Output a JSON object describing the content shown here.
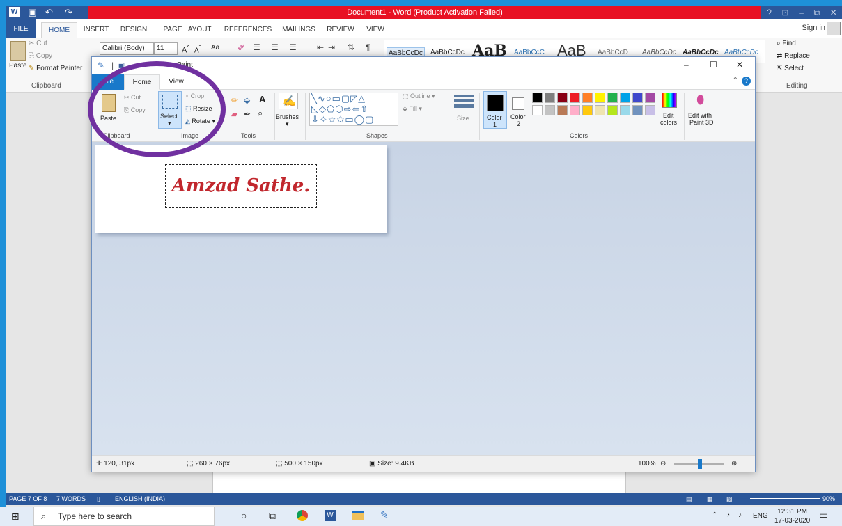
{
  "word": {
    "title": "Document1 - Word (Product Activation Failed)",
    "ctrl_icons": [
      "?",
      "⊡",
      "–",
      "⧉",
      "✕"
    ],
    "tabs": [
      "FILE",
      "HOME",
      "INSERT",
      "DESIGN",
      "PAGE LAYOUT",
      "REFERENCES",
      "MAILINGS",
      "REVIEW",
      "VIEW"
    ],
    "sign_in": "Sign in",
    "clipboard": {
      "paste": "Paste",
      "cut": "Cut",
      "copy": "Copy",
      "format_painter": "Format Painter",
      "label": "Clipboard"
    },
    "font": {
      "name": "Calibri (Body)",
      "size": "11",
      "case": "Aa"
    },
    "styles": [
      "AaBbCcDc",
      "AaBbCcDc",
      "AaB",
      "AaBbCcC",
      "AaB",
      "AaBbCcD",
      "AaBbCcDc",
      "AaBbCcDc",
      "AaBbCcDc"
    ],
    "editing": {
      "find": "Find",
      "replace": "Replace",
      "select": "Select",
      "label": "Editing"
    },
    "status": {
      "page": "PAGE 7 OF 8",
      "words": "7 WORDS",
      "language": "ENGLISH (INDIA)",
      "zoom": "90%"
    }
  },
  "paint": {
    "title": "Untitled - Paint",
    "title_suffix": "- Paint",
    "ctrl_icons": [
      "–",
      "☐",
      "✕"
    ],
    "tabs": [
      "File",
      "Home",
      "View"
    ],
    "clipboard": {
      "paste": "Paste",
      "cut": "Cut",
      "copy": "Copy",
      "label": "Clipboard"
    },
    "image": {
      "select": "Select",
      "crop": "Crop",
      "resize": "Resize",
      "rotate": "Rotate",
      "label": "Image"
    },
    "tools_label": "Tools",
    "brushes": "Brushes",
    "shapes": {
      "outline": "Outline",
      "fill": "Fill",
      "label": "Shapes"
    },
    "size": "Size",
    "colors": {
      "color1": "Color",
      "color1_num": "1",
      "color2": "Color",
      "color2_num": "2",
      "edit": "Edit",
      "edit2": "colors",
      "label": "Colors",
      "paint3d": "Edit with",
      "paint3d2": "Paint 3D"
    },
    "palette_row1": [
      "#000000",
      "#7f7f7f",
      "#880015",
      "#ed1c24",
      "#ff7f27",
      "#fff200",
      "#22b14c",
      "#00a2e8",
      "#3f48cc",
      "#a349a4"
    ],
    "palette_row2": [
      "#ffffff",
      "#c3c3c3",
      "#b97a57",
      "#ffaec9",
      "#ffc90e",
      "#efe4b0",
      "#b5e61d",
      "#99d9ea",
      "#7092be",
      "#c8bfe7"
    ],
    "canvas_text": "Amzad Sathe.",
    "status": {
      "cursor": "120, 31px",
      "selection": "260 × 76px",
      "canvas_size": "500 × 150px",
      "file_size": "Size: 9.4KB",
      "zoom": "100%"
    }
  },
  "taskbar": {
    "search_placeholder": "Type here to search",
    "tray_lang": "ENG",
    "time": "12:31 PM",
    "date": "17-03-2020"
  }
}
